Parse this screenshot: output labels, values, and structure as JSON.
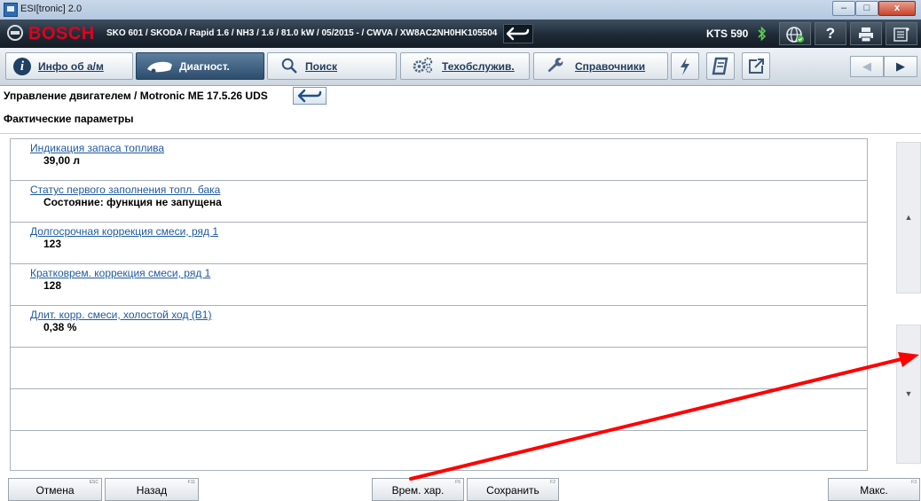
{
  "window": {
    "title": "ESI[tronic] 2.0",
    "controls": {
      "minimize": "–",
      "maximize": "□",
      "close": "x"
    }
  },
  "header": {
    "brand": "BOSCH",
    "vehicle": "SKO 601 / SKODA / Rapid 1.6 / NH3 / 1.6 / 81.0 kW / 05/2015 - / CWVA / XW8AC2NH0HK105504",
    "device": "KTS 590",
    "help_glyph": "?"
  },
  "nav": {
    "tabs": [
      {
        "label": "Инфо об а/м",
        "icon": "info-icon"
      },
      {
        "label": "Диагност.",
        "icon": "car-icon"
      },
      {
        "label": "Поиск",
        "icon": "magnifier-icon"
      },
      {
        "label": "Техобслужив.",
        "icon": "gears-icon"
      },
      {
        "label": "Справочники",
        "icon": "wrench-icon"
      }
    ],
    "icons": [
      "lightning-icon",
      "manual-icon",
      "external-link-icon"
    ],
    "prev_glyph": "◀",
    "next_glyph": "▶"
  },
  "breadcrumb": "Управление двигателем / Motronic ME 17.5.26 UDS",
  "section_title": "Фактические параметры",
  "parameters": [
    {
      "name": "Индикация запаса топлива",
      "value": "39,00 л"
    },
    {
      "name": "Статус первого заполнения топл. бака",
      "value": "Состояние: функция не запущена"
    },
    {
      "name": "Долгосрочная коррекция смеси, ряд 1",
      "value": "123"
    },
    {
      "name": "Кратковрем. коррекция смеси, ряд 1",
      "value": "128"
    },
    {
      "name": "Длит. корр. смеси, холостой ход (В1)",
      "value": "0,38 %"
    }
  ],
  "scroll": {
    "up_glyph": "▲",
    "down_glyph": "▼"
  },
  "footer": {
    "cancel": {
      "label": "Отмена",
      "key": "ESC"
    },
    "back": {
      "label": "Назад",
      "key": "F11"
    },
    "timechart": {
      "label": "Врем. хар.",
      "key": "F5"
    },
    "save": {
      "label": "Сохранить",
      "key": "F2"
    },
    "max": {
      "label": "Макс.",
      "key": "F3"
    }
  },
  "colors": {
    "brand_red": "#e2001a",
    "link_blue": "#1f5aa0",
    "annotation_red": "#ff0000",
    "header_dark": "#1e2a36",
    "active_tab": "#2e4d6d"
  }
}
